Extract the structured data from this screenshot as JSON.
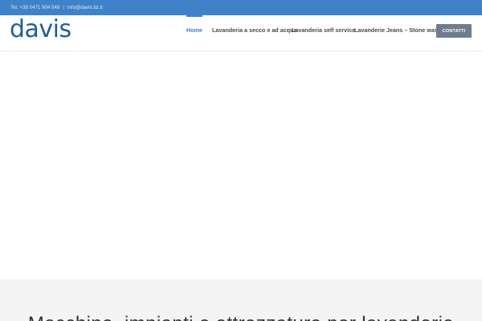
{
  "topbar": {
    "phone": "Tel. +39 0471 904 549",
    "separator": "|",
    "email": "info@davis.bz.it",
    "bg_color": "#3f82c8"
  },
  "header": {
    "logo_text": "davis",
    "logo_color": "#1e5f96"
  },
  "nav": {
    "items": [
      {
        "label": "Home",
        "active": true
      },
      {
        "label": "Lavanderia a secco e ad acqua",
        "active": false
      },
      {
        "label": "Lavanderia self service",
        "active": false
      },
      {
        "label": "Lavanderie Jeans – Stone wash",
        "active": false
      }
    ],
    "contact_label": "CONTATTI",
    "accent_color": "#3f82c8"
  },
  "section": {
    "heading": "Macchine, impianti e attrezzature per lavanderie"
  }
}
